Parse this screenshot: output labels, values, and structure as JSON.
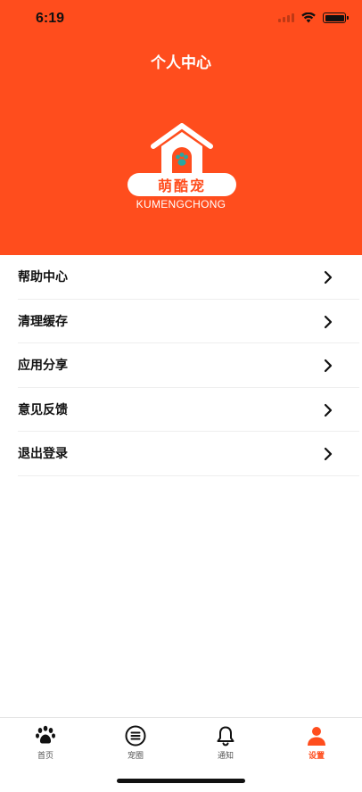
{
  "status_bar": {
    "time": "6:19"
  },
  "header": {
    "title": "个人中心",
    "logo_text": "萌酷宠",
    "logo_subtitle": "KUMENGCHONG"
  },
  "menu": [
    {
      "label": "帮助中心"
    },
    {
      "label": "清理缓存"
    },
    {
      "label": "应用分享"
    },
    {
      "label": "意见反馈"
    },
    {
      "label": "退出登录"
    }
  ],
  "tabs": [
    {
      "label": "首页",
      "icon": "paw-icon"
    },
    {
      "label": "宠圈",
      "icon": "list-circle-icon"
    },
    {
      "label": "通知",
      "icon": "bell-icon"
    },
    {
      "label": "设置",
      "icon": "person-icon",
      "active": true
    }
  ],
  "colors": {
    "accent": "#ff4d1d",
    "logo_teal": "#2aa6a0"
  }
}
